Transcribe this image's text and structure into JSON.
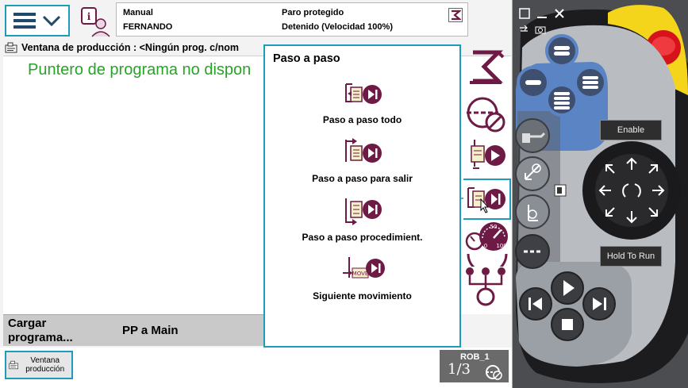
{
  "header": {
    "mode": "Manual",
    "user": "FERNANDO",
    "safety_state": "Paro protegido",
    "robot_state": "Detenido (Velocidad 100%)"
  },
  "window": {
    "title": "Ventana de producción : <Ningún prog. c/nom",
    "message": "Puntero de programa no dispon"
  },
  "bottom_bar": {
    "load_program": "Cargar programa...",
    "pp_to_main": "PP a Main"
  },
  "taskbar": {
    "production_window": "Ventana producción",
    "robot": "ROB_1",
    "fraction": "1/3"
  },
  "popup": {
    "title": "Paso a paso",
    "items": [
      {
        "label": "Paso a paso todo",
        "icon": "step-into-icon"
      },
      {
        "label": "Paso a paso para salir",
        "icon": "step-out-icon"
      },
      {
        "label": "Paso a paso procedimient.",
        "icon": "step-over-icon"
      },
      {
        "label": "Siguiente movimiento",
        "icon": "next-move-icon"
      }
    ]
  },
  "toolbar": {
    "speed_min": "0",
    "speed_max": "100",
    "speed_mid": "50"
  },
  "pendant": {
    "enable": "Enable",
    "hold_to_run": "Hold To Run"
  },
  "colors": {
    "accent": "#1e9bb8",
    "icon_dark": "#6d1a45",
    "message_green": "#27a327",
    "pendant_body": "#4b4d50",
    "pendant_blue": "#5a84c4",
    "emergency_red": "#d6121b",
    "emergency_yellow": "#f4d51c"
  }
}
